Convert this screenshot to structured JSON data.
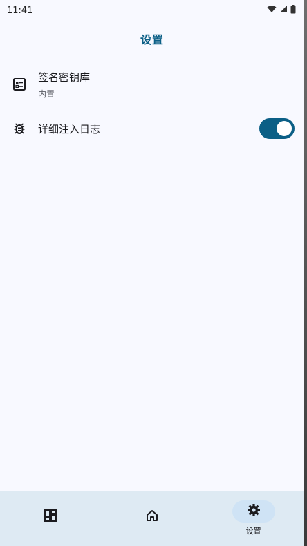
{
  "status_bar": {
    "time": "11:41",
    "icons": [
      "wifi-icon",
      "signal-icon",
      "battery-icon"
    ]
  },
  "header": {
    "title": "设置"
  },
  "settings": [
    {
      "icon": "keystore-icon",
      "label": "签名密钥库",
      "sublabel": "内置",
      "type": "item"
    },
    {
      "icon": "bug-icon",
      "label": "详细注入日志",
      "type": "toggle",
      "enabled": true
    }
  ],
  "bottom_nav": [
    {
      "icon": "dashboard-icon",
      "label": "",
      "active": false
    },
    {
      "icon": "home-icon",
      "label": "",
      "active": false
    },
    {
      "icon": "gear-icon",
      "label": "设置",
      "active": true
    }
  ],
  "colors": {
    "accent": "#0b5f86",
    "background": "#f8f9ff",
    "nav_background": "#deeaf3",
    "nav_active_pill": "#cfe3f5"
  }
}
